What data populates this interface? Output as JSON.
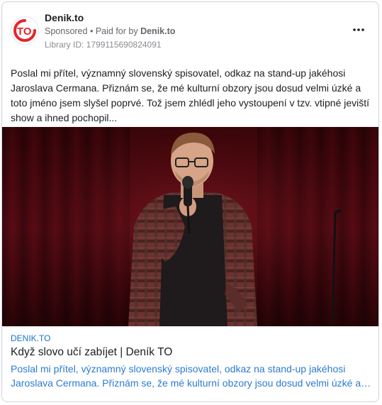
{
  "ad": {
    "page_name": "Denik.to",
    "sponsored": "Sponsored",
    "separator": "•",
    "paid_for_prefix": "Paid for by",
    "paid_for_by": "Denik.to",
    "library_id": "Library ID: 1799115690824091",
    "more_icon": "more-horizontal-icon",
    "body_lines": [
      "Poslal mi přítel, významný slovenský spisovatel, odkaz na stand-up jakéhosi",
      "Jaroslava Cermana. Přiznám se, že mé kulturní obzory jsou dosud velmi úzké a",
      "toto jméno jsem slyšel poprvé. Tož jsem zhlédl jeho vystoupení v tzv. vtipné jeviští",
      "show a ihned pochopil..."
    ]
  },
  "logo": {
    "text": "TO",
    "color": "#e3262c"
  },
  "link": {
    "domain": "DENIK.TO",
    "title": "Když slovo učí zabíjet | Deník TO",
    "desc_lines": [
      "Poslal mi přítel, významný slovenský spisovatel, odkaz na stand-up jakéhosi",
      "Jaroslava Cermana. Přiznám se, že mé kulturní obzory jsou dosud velmi úzké a t…"
    ]
  },
  "colors": {
    "link_blue": "#2d7bd0",
    "curtain": "#5a0d14",
    "text_primary": "#1c1e21",
    "text_secondary": "#65676b"
  }
}
